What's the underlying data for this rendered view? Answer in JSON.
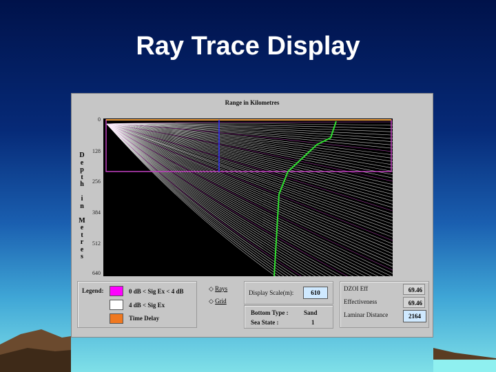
{
  "title": "Ray Trace Display",
  "plot": {
    "range_label": "Range in Kilometres",
    "depth_label": [
      "D",
      "e",
      "p",
      "t",
      "h",
      "",
      "i",
      "n",
      "",
      "M",
      "e",
      "t",
      "r",
      "e",
      "s"
    ],
    "depth_ticks": [
      "0",
      "128",
      "256",
      "384",
      "512",
      "640"
    ]
  },
  "legend": {
    "label": "Legend:",
    "items": [
      {
        "text": "0 dB < Sig Ex < 4 dB",
        "color": "#ff00ff"
      },
      {
        "text": "4 dB < Sig Ex",
        "color": "#ffffff"
      },
      {
        "text": "Time Delay",
        "color": "#f07820"
      }
    ]
  },
  "options": {
    "rays": "Rays",
    "grid": "Grid"
  },
  "display_scale": {
    "label": "Display Scale(m):",
    "value": "610"
  },
  "bottom": {
    "type_label": "Bottom Type :",
    "type_value": "Sand",
    "sea_label": "Sea State :",
    "sea_value": "1"
  },
  "metrics": {
    "dzoi_label": "DZOI Eff",
    "dzoi_value": "69.46",
    "eff_label": "Effectiveness",
    "eff_value": "69.46",
    "laminar_label": "Laminar Distance",
    "laminar_value": "2164"
  }
}
